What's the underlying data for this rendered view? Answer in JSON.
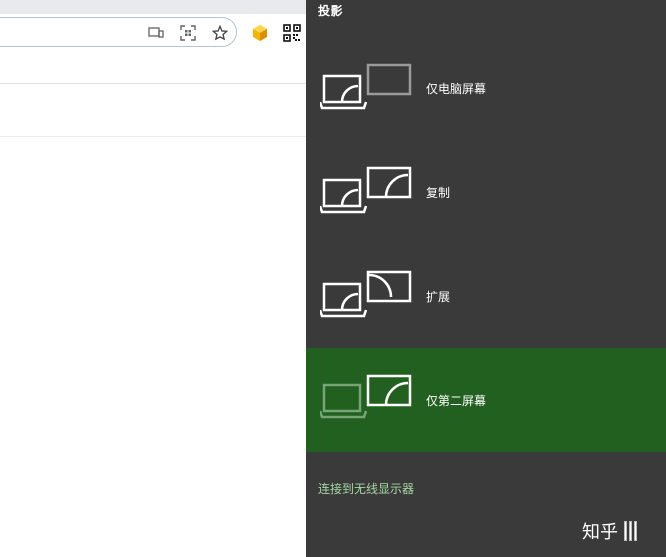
{
  "browser": {
    "toolbar_icons": [
      {
        "name": "cast-icon"
      },
      {
        "name": "screenshot-icon"
      },
      {
        "name": "bookmark-star-icon"
      },
      {
        "name": "extension-icon"
      },
      {
        "name": "qr-code-icon"
      }
    ]
  },
  "project_panel": {
    "title": "投影",
    "options": [
      {
        "label": "仅电脑屏幕",
        "selected": false
      },
      {
        "label": "复制",
        "selected": false
      },
      {
        "label": "扩展",
        "selected": false
      },
      {
        "label": "仅第二屏幕",
        "selected": true
      }
    ],
    "connect_link": "连接到无线显示器",
    "selected_color": "#21601f",
    "panel_color": "#3a3a3a"
  },
  "watermark": {
    "text": "知乎"
  }
}
